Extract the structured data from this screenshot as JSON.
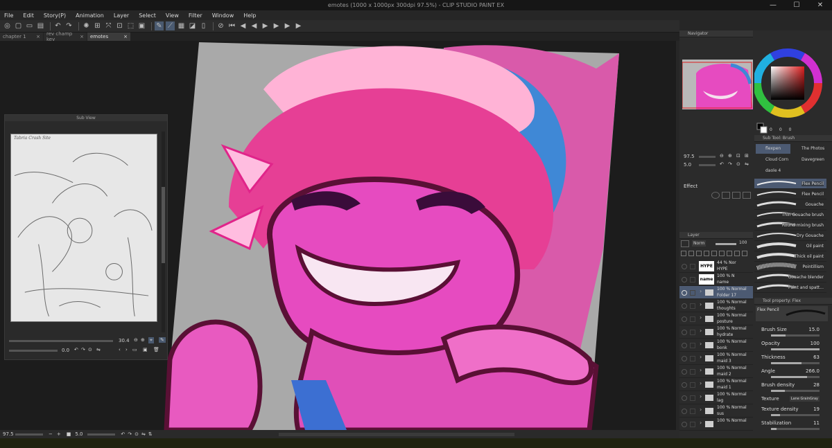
{
  "window": {
    "title": "emotes (1000 x 1000px 300dpi 97.5%) - CLIP STUDIO PAINT EX",
    "minimize": "—",
    "maximize": "☐",
    "close": "✕"
  },
  "menu": [
    "File",
    "Edit",
    "Story(P)",
    "Animation",
    "Layer",
    "Select",
    "View",
    "Filter",
    "Window",
    "Help"
  ],
  "tabs": [
    {
      "label": "chapter 1",
      "close": "×"
    },
    {
      "label": "rev champ key",
      "close": "×"
    },
    {
      "label": "emotes",
      "close": "×"
    }
  ],
  "subview": {
    "title": "Sub View",
    "sketch_caption": "Tabria Crash Site",
    "zoom": "30.4",
    "angle": "0.0"
  },
  "navigator": {
    "title": "Navigator",
    "zoom": "97.5",
    "angle": "5.0"
  },
  "effect": {
    "title": "Effect"
  },
  "layer": {
    "title": "Layer",
    "blend_mode": "Norm",
    "opacity": "100",
    "rows": [
      {
        "mode": "44 % Nor",
        "name": "HYPE",
        "thumb": "HYPE"
      },
      {
        "mode": "100 % N",
        "name": "name",
        "thumb": "name"
      },
      {
        "mode": "100 % Normal",
        "name": "Folder 17"
      },
      {
        "mode": "100 % Normal",
        "name": "thoughts"
      },
      {
        "mode": "100 % Normal",
        "name": "posture"
      },
      {
        "mode": "100 % Normal",
        "name": "hydrate"
      },
      {
        "mode": "100 % Normal",
        "name": "bonk"
      },
      {
        "mode": "100 % Normal",
        "name": "maid 3"
      },
      {
        "mode": "100 % Normal",
        "name": "maid 2"
      },
      {
        "mode": "100 % Normal",
        "name": "maid 1"
      },
      {
        "mode": "100 % Normal",
        "name": "lag"
      },
      {
        "mode": "100 % Normal",
        "name": "sus"
      },
      {
        "mode": "100 % Normal",
        "name": ""
      }
    ]
  },
  "color": {
    "values": [
      "0",
      "0",
      "0"
    ]
  },
  "subtool": {
    "title": "Sub Tool: Brush",
    "groups": [
      "flexpen",
      "The Photos",
      "Cloud Corn",
      "Davegreen",
      "daole 4"
    ]
  },
  "brushes": [
    "Flex Pencil",
    "Flex Pencil",
    "Gouache",
    "Thin Gouache brush",
    "Round mixing brush",
    "Dry Gouache",
    "Oil paint",
    "Thick oil paint",
    "Pointillism",
    "Gouache blender",
    "Paint and spatt..."
  ],
  "toolprop": {
    "title": "Tool property: Flex",
    "brush_name": "Flex Pencil",
    "props": [
      {
        "label": "Brush Size",
        "value": "15.0",
        "level": 0.3
      },
      {
        "label": "Opacity",
        "value": "100",
        "level": 1.0
      },
      {
        "label": "Thickness",
        "value": "63",
        "level": 0.63
      },
      {
        "label": "Angle",
        "value": "266.0",
        "level": 0.74
      },
      {
        "label": "Brush density",
        "value": "28",
        "level": 0.28
      },
      {
        "label": "Texture",
        "value": "Lane GrainGray"
      },
      {
        "label": "Texture density",
        "value": "19",
        "level": 0.19
      },
      {
        "label": "Stabilization",
        "value": "11",
        "level": 0.11
      }
    ]
  },
  "status": {
    "zoom": "97.5",
    "angle": "5.0"
  }
}
